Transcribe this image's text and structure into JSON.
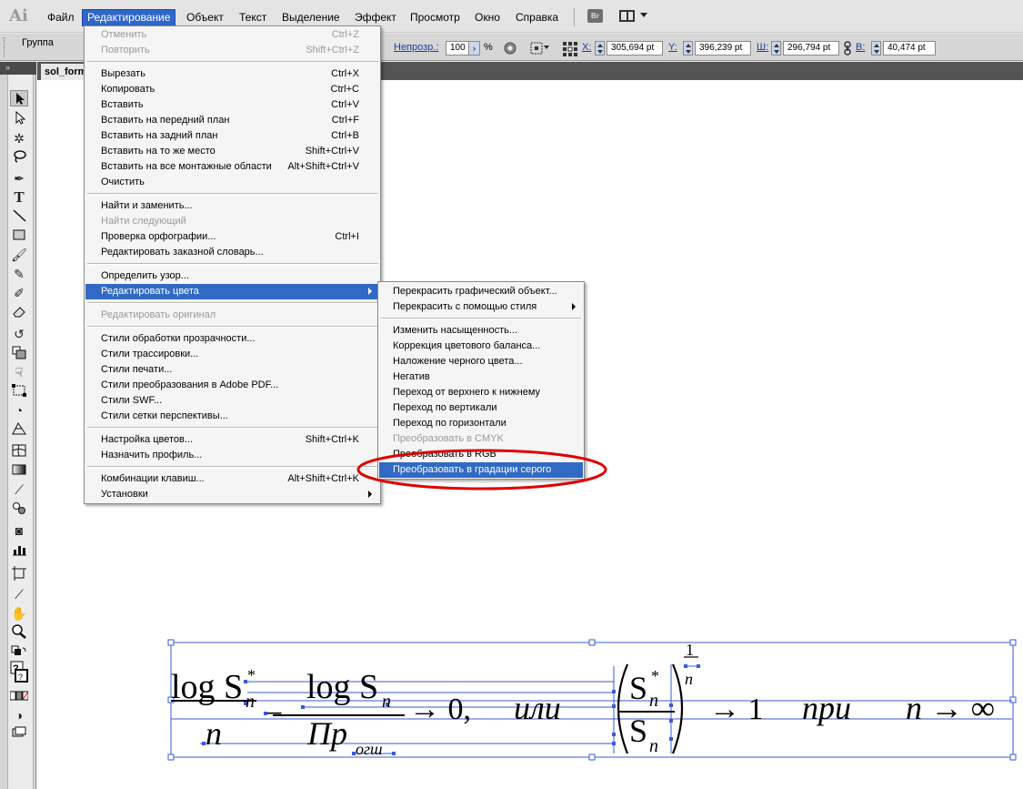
{
  "app": {
    "logo": "Ai"
  },
  "menubar": {
    "items": [
      "Файл",
      "Редактирование",
      "Объект",
      "Текст",
      "Выделение",
      "Эффект",
      "Просмотр",
      "Окно",
      "Справка"
    ],
    "active": "Редактирование",
    "bridge_label": "Br"
  },
  "controlbar": {
    "selection_label": "Группа",
    "opacity_label": "Непрозр.:",
    "opacity_value": "100",
    "opacity_unit": "%",
    "x_label": "X:",
    "x_value": "305,694 pt",
    "y_label": "Y:",
    "y_value": "396,239 pt",
    "w_label": "Ш:",
    "w_value": "296,794 pt",
    "h_label": "В:",
    "h_value": "40,474 pt"
  },
  "document": {
    "tab_title": "sol_form"
  },
  "toolbar": {
    "tools": [
      "selection-tool",
      "direct-selection-tool",
      "magic-wand-tool",
      "lasso-tool",
      "pen-tool",
      "type-tool",
      "line-tool",
      "rectangle-tool",
      "paintbrush-tool",
      "pencil-tool",
      "blob-brush-tool",
      "eraser-tool",
      "rotate-tool",
      "scale-tool",
      "warp-tool",
      "free-transform-tool",
      "shape-builder-tool",
      "perspective-grid-tool",
      "mesh-tool",
      "gradient-tool",
      "eyedropper-tool",
      "blend-tool",
      "symbol-sprayer-tool",
      "column-graph-tool",
      "artboard-tool",
      "slice-tool",
      "hand-tool",
      "zoom-tool",
      "default-colors",
      "fill-stroke",
      "color-modes",
      "draw-modes",
      "screen-mode"
    ]
  },
  "edit_menu": {
    "items": [
      {
        "label": "Отменить",
        "shortcut": "Ctrl+Z",
        "disabled": true
      },
      {
        "label": "Повторить",
        "shortcut": "Shift+Ctrl+Z",
        "disabled": true
      },
      {
        "label": "Вырезать",
        "shortcut": "Ctrl+X"
      },
      {
        "label": "Копировать",
        "shortcut": "Ctrl+C"
      },
      {
        "label": "Вставить",
        "shortcut": "Ctrl+V"
      },
      {
        "label": "Вставить на передний план",
        "shortcut": "Ctrl+F"
      },
      {
        "label": "Вставить на задний план",
        "shortcut": "Ctrl+B"
      },
      {
        "label": "Вставить на то же место",
        "shortcut": "Shift+Ctrl+V"
      },
      {
        "label": "Вставить на все монтажные области",
        "shortcut": "Alt+Shift+Ctrl+V"
      },
      {
        "label": "Очистить",
        "shortcut": ""
      },
      {
        "label": "Найти и заменить...",
        "shortcut": ""
      },
      {
        "label": "Найти следующий",
        "shortcut": "",
        "disabled": true
      },
      {
        "label": "Проверка орфографии...",
        "shortcut": "Ctrl+I"
      },
      {
        "label": "Редактировать заказной словарь...",
        "shortcut": ""
      },
      {
        "label": "Определить узор...",
        "shortcut": ""
      },
      {
        "label": "Редактировать цвета",
        "shortcut": "",
        "submenu": true,
        "highlighted": true
      },
      {
        "label": "Редактировать оригинал",
        "shortcut": "",
        "disabled": true
      },
      {
        "label": "Стили обработки прозрачности...",
        "shortcut": ""
      },
      {
        "label": "Стили трассировки...",
        "shortcut": ""
      },
      {
        "label": "Стили печати...",
        "shortcut": ""
      },
      {
        "label": "Стили преобразования в Adobe PDF...",
        "shortcut": ""
      },
      {
        "label": "Стили SWF...",
        "shortcut": ""
      },
      {
        "label": "Стили сетки перспективы...",
        "shortcut": ""
      },
      {
        "label": "Настройка цветов...",
        "shortcut": "Shift+Ctrl+K"
      },
      {
        "label": "Назначить профиль...",
        "shortcut": ""
      },
      {
        "label": "Комбинации клавиш...",
        "shortcut": "Alt+Shift+Ctrl+K"
      },
      {
        "label": "Установки",
        "shortcut": "",
        "submenu": true
      }
    ]
  },
  "colors_submenu": {
    "items": [
      {
        "label": "Перекрасить графический объект..."
      },
      {
        "label": "Перекрасить с помощью стиля",
        "submenu": true
      },
      {
        "label": "Изменить насыщенность..."
      },
      {
        "label": "Коррекция цветового баланса..."
      },
      {
        "label": "Наложение черного цвета..."
      },
      {
        "label": "Негатив"
      },
      {
        "label": "Переход от верхнего к нижнему"
      },
      {
        "label": "Переход по вертикали"
      },
      {
        "label": "Переход по горизонтали"
      },
      {
        "label": "Преобразовать в CMYK",
        "disabled": true
      },
      {
        "label": "Преобразовать в RGB"
      },
      {
        "label": "Преобразовать в градации серого",
        "highlighted": true
      }
    ]
  },
  "formula": {
    "log1": "log",
    "s1": "S",
    "star1": "*",
    "n1": "n",
    "minus": "−",
    "log2": "log",
    "s2": "S",
    "n2": "n",
    "arrow0": "→ 0,",
    "ili": "или",
    "s3": "S",
    "star3": "*",
    "n3": "n",
    "s4": "S",
    "n4": "n",
    "exp_num": "1",
    "exp_den": "n",
    "arrow1": "→ 1",
    "pri": "при",
    "n_arrow_inf": "n → ∞",
    "n_den": "n",
    "pr": "Пр",
    "ogsh": "огш"
  },
  "colors": {
    "menu_highlight": "#316ac5",
    "annotation_ellipse": "#e00000",
    "selection_guides": "#3a5ad6"
  }
}
